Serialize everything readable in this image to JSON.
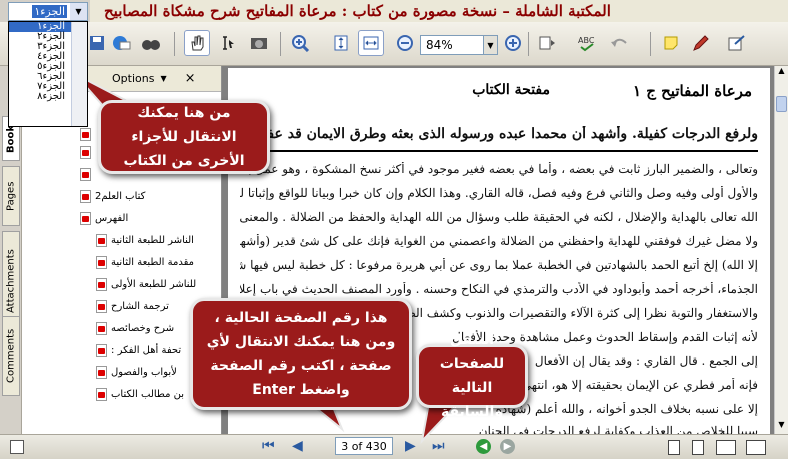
{
  "window": {
    "title": "المكتبة الشاملة – نسخة مصورة من كتاب : مرعاة المفاتيح شرح مشكاة المصابيح"
  },
  "volume_select": {
    "selected": "الجزء١",
    "options": [
      "الجزء١",
      "الجزء٢",
      "الجزء٣",
      "الجزء٤",
      "الجزء٥",
      "الجزء٦",
      "الجزء٧",
      "الجزء٨"
    ],
    "active_index": 0
  },
  "toolbar": {
    "zoom": "84%"
  },
  "left_tabs": {
    "bookmarks": "Book",
    "pages": "Pages",
    "attachments": "Attachments",
    "comments": "Comments"
  },
  "nav_panel": {
    "options_label": "Options",
    "close": "×",
    "items": [
      "",
      "",
      "",
      "2كتاب العلم",
      "الفهرس",
      "الناشر للطبعة الثانية",
      "مقدمة الطبعة الثانية",
      "للناشر للطبعة الأولى",
      "ترجمة الشارح",
      "شرح وخصائصه",
      ": تحفة أهل الفكر",
      "لأبواب والفصول",
      "بن مطالب الكتاب"
    ]
  },
  "document": {
    "header_right": "مرعاة المفاتيح ج ١",
    "header_center": "مفتحة الكتاب",
    "lines": [
      "ولرفع الدرجات كفيلة. وأشهد أن محمدا عبده ورسوله الذى بعثه وطرق الايمان قد عفت",
      "وتعالى ، والضمير البارز ثابت في بعضه ، وأما في بعضه فغير موجود في أكثر نسخ المشكوة ، وهو عمل بالجائزين ،",
      "والأول أولى وفيه وصل والثاني فرع وفيه فصل، قاله القاري. وهذا الكلام وإن كان خبرا وبيانا للواقع وإثباتا لتفرد",
      "الله تعالى بالهداية والإضلال ، لكنه في الحقيقة طلب وسؤال من الله الهداية والحفظ من الضلالة . والمعنى : لا هادي",
      "ولا مضل غيرك فوفقني للهداية واحفظني من الضلالة واعصمني من الغواية فإنك على كل شئ قدير (وأشهد أن لا إله",
      "إلا الله) إلخ أتبع الحمد بالشهادتين في الخطبة عملا بما روى عن أبي هريرة مرفوعا : كل خطبة ليس فيها شهادة كاليد",
      "الجذماء، أخرجه أحمد وأبوداود في الأدب والترمذي في النكاح وحسنه . وأورد المصنف الحديث في باب إعلان النكاح",
      "والاستغفار والتوبة نظرا إلى كثرة الآلاء والتقصيرات والذنوب وكشف الصفات",
      "لأنه إثبات القدم وإسقاط الحدوث وعمل مشاهدة وحدة الأفعال",
      "إلى الجمع . قال القاري : وقد يقال إن الأفعال",
      "فإنه أمر فطري عن الإيمان بحقيقته إلا هو، انتهى. بعد",
      "إلا على نسبه بخلاف الجدو أخوانه ، والله أعلم (شهادة",
      "سببا للخلاص من العذاب وكفاية لرفع الدرجات في الجنان"
    ]
  },
  "callouts": {
    "volumes": "من هنا يمكنك الانتقال للأجزاء الأخرى من الكتاب",
    "page_number": "هذا رقم الصفحة الحالية ، ومن هنا يمكنك الانتقال لأي صفحة ، اكتب رقم الصفحة واضغط Enter",
    "navigation": "التنقل للصفحات التالية والسابقة"
  },
  "status": {
    "page_display": "3 of 430"
  }
}
